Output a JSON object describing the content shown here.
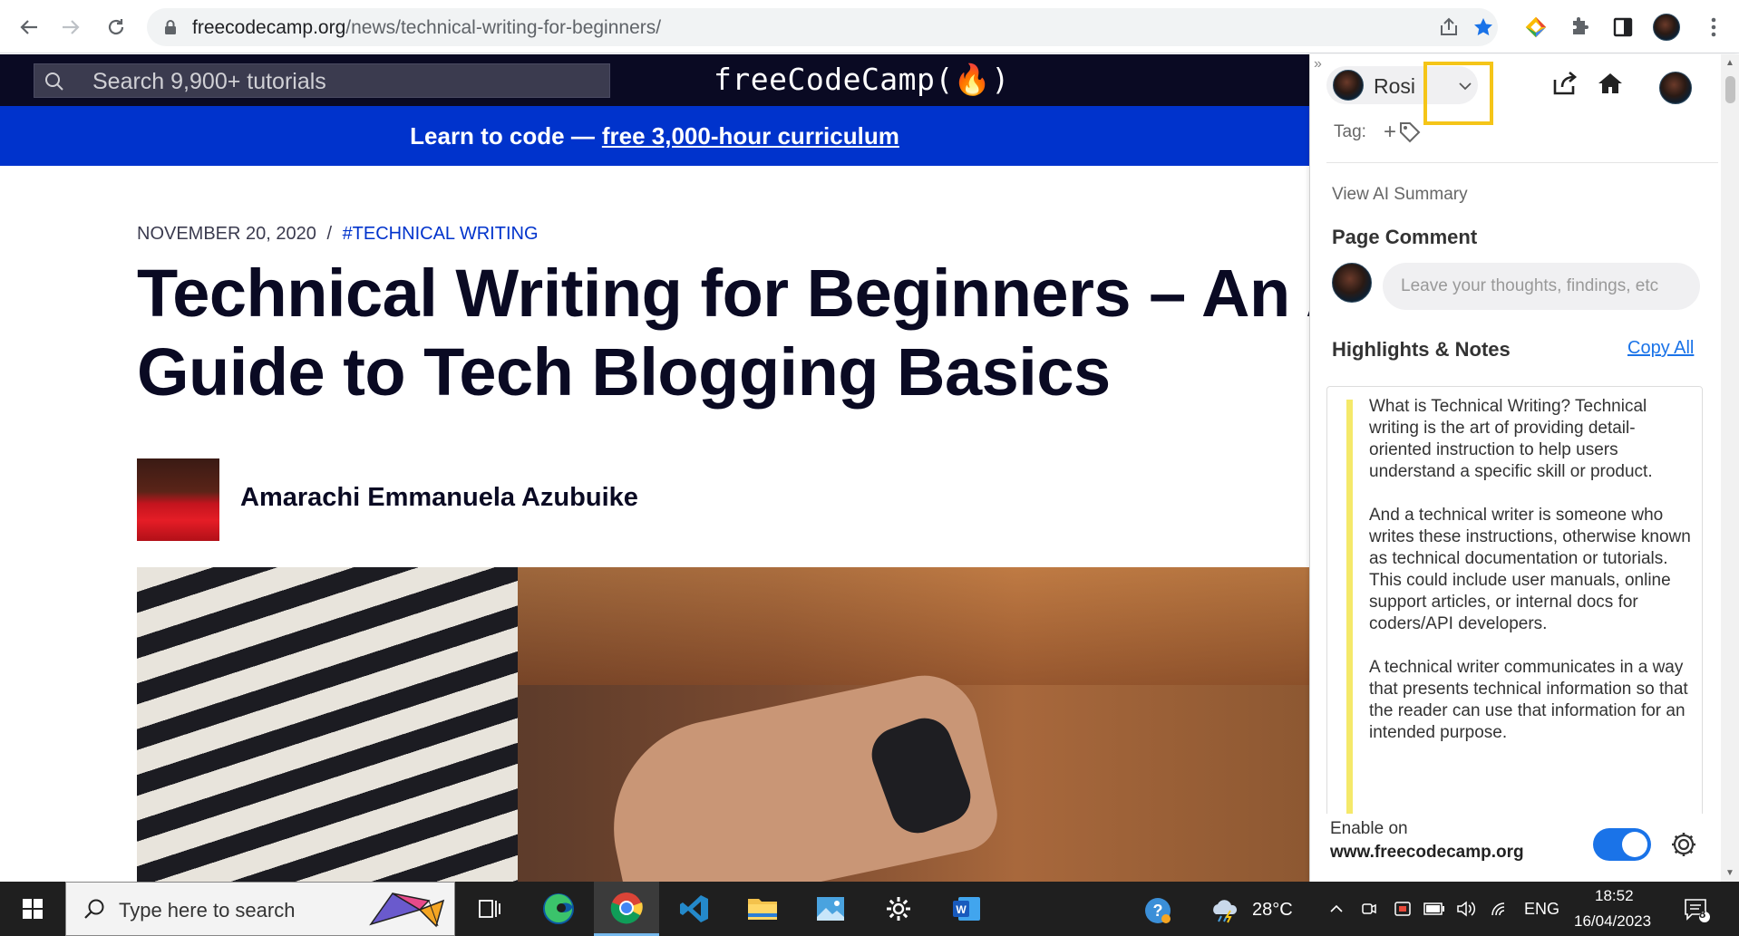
{
  "browser": {
    "url_domain": "freecodecamp.org",
    "url_path": "/news/technical-writing-for-beginners/"
  },
  "fcc": {
    "search_placeholder": "Search 9,900+ tutorials",
    "logo": "freeCodeCamp(🔥)",
    "banner_text": "Learn to code —",
    "banner_link": "free 3,000-hour curriculum",
    "date": "NOVEMBER 20, 2020",
    "separator": "/",
    "tag": "#TECHNICAL WRITING",
    "title_line1": "Technical Writing for Beginners – An A-",
    "title_line2": "Guide to Tech Blogging Basics",
    "author": "Amarachi Emmanuela Azubuike"
  },
  "panel": {
    "user_name": "Rosi",
    "tag_label": "Tag:",
    "tag_add": "+",
    "ai_summary": "View AI Summary",
    "page_comment_title": "Page Comment",
    "comment_placeholder": "Leave your thoughts, findings, etc",
    "highlights_title": "Highlights & Notes",
    "copy_all": "Copy All",
    "note_paragraphs": [
      "What is Technical Writing? Technical writing is the art of providing detail-oriented instruction to help users understand a specific skill or product.",
      "And a technical writer is someone who writes these instructions, otherwise known as technical documentation or tutorials. This could include user manuals, online support articles, or internal docs for coders/API developers.",
      "A technical writer communicates in a way that presents technical information so that the reader can use that information for an intended purpose."
    ],
    "enable_label": "Enable on",
    "enable_site": "www.freecodecamp.org",
    "enabled": true,
    "highlight_color": "#f5c518"
  },
  "taskbar": {
    "search_text": "Type here to search",
    "weather": "28°C",
    "language": "ENG",
    "time": "18:52",
    "date": "16/04/2023",
    "notification_count": "8"
  }
}
